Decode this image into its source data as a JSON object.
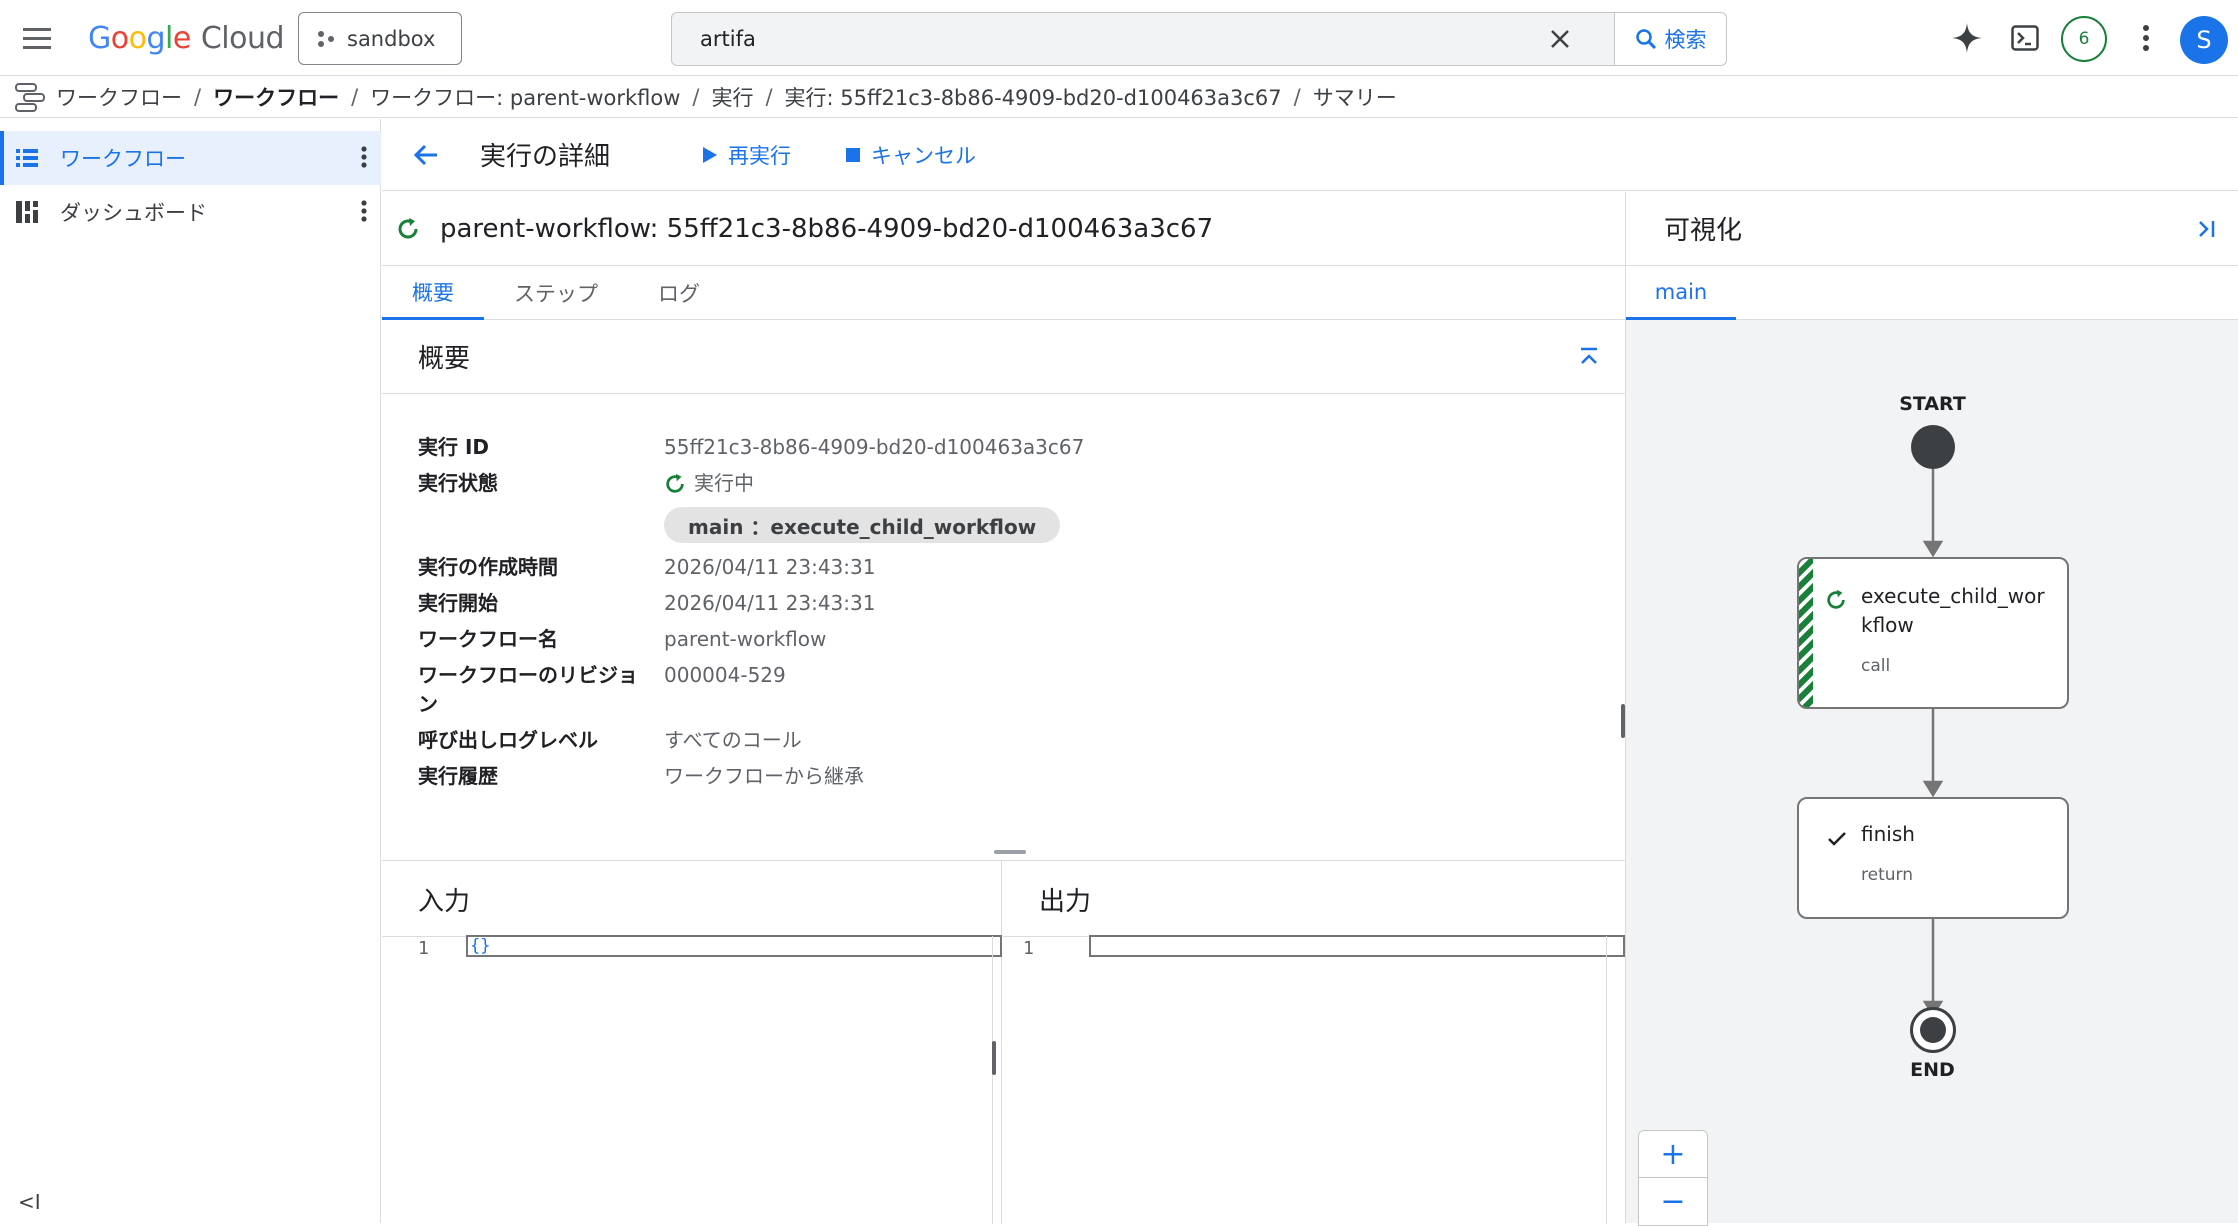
{
  "topbar": {
    "logo_google": "Google",
    "logo_cloud": "Cloud",
    "project": "sandbox",
    "search_value": "artifa",
    "search_button": "検索",
    "notifications": "6",
    "avatar": "S"
  },
  "breadcrumb": {
    "items": [
      "ワークフロー",
      "ワークフロー",
      "ワークフロー: parent-workflow",
      "実行",
      "実行: 55ff21c3-8b86-4909-bd20-d100463a3c67",
      "サマリー"
    ]
  },
  "sidebar": {
    "items": [
      {
        "label": "ワークフロー",
        "icon": "list-icon"
      },
      {
        "label": "ダッシュボード",
        "icon": "dashboard-icon"
      }
    ],
    "collapse": "<I"
  },
  "header": {
    "title": "実行の詳細",
    "rerun": "再実行",
    "cancel": "キャンセル"
  },
  "execution": {
    "title": "parent-workflow: 55ff21c3-8b86-4909-bd20-d100463a3c67",
    "tabs": [
      "概要",
      "ステップ",
      "ログ"
    ],
    "summary_title": "概要",
    "rows": {
      "id_label": "実行 ID",
      "id_value": "55ff21c3-8b86-4909-bd20-d100463a3c67",
      "state_label": "実行状態",
      "state_value": "実行中",
      "state_chip": "main ：execute_child_workflow",
      "created_label": "実行の作成時間",
      "created_value": "2026/04/11 23:43:31",
      "start_label": "実行開始",
      "start_value": "2026/04/11 23:43:31",
      "wf_name_label": "ワークフロー名",
      "wf_name_value": "parent-workflow",
      "revision_label": "ワークフローのリビジョン",
      "revision_value": "000004-529",
      "log_level_label": "呼び出しログレベル",
      "log_level_value": "すべてのコール",
      "history_label": "実行履歴",
      "history_value": "ワークフローから継承"
    },
    "input_title": "入力",
    "output_title": "出力",
    "input_line_no": "1",
    "input_code": "{}",
    "output_line_no": "1"
  },
  "viz": {
    "title": "可視化",
    "tab": "main",
    "start_label": "START",
    "end_label": "END",
    "node1_name_l1": "execute_child_wor",
    "node1_name_l2": "kflow",
    "node1_kind": "call",
    "node2_name": "finish",
    "node2_kind": "return",
    "zoom_in": "+",
    "zoom_out": "−"
  }
}
